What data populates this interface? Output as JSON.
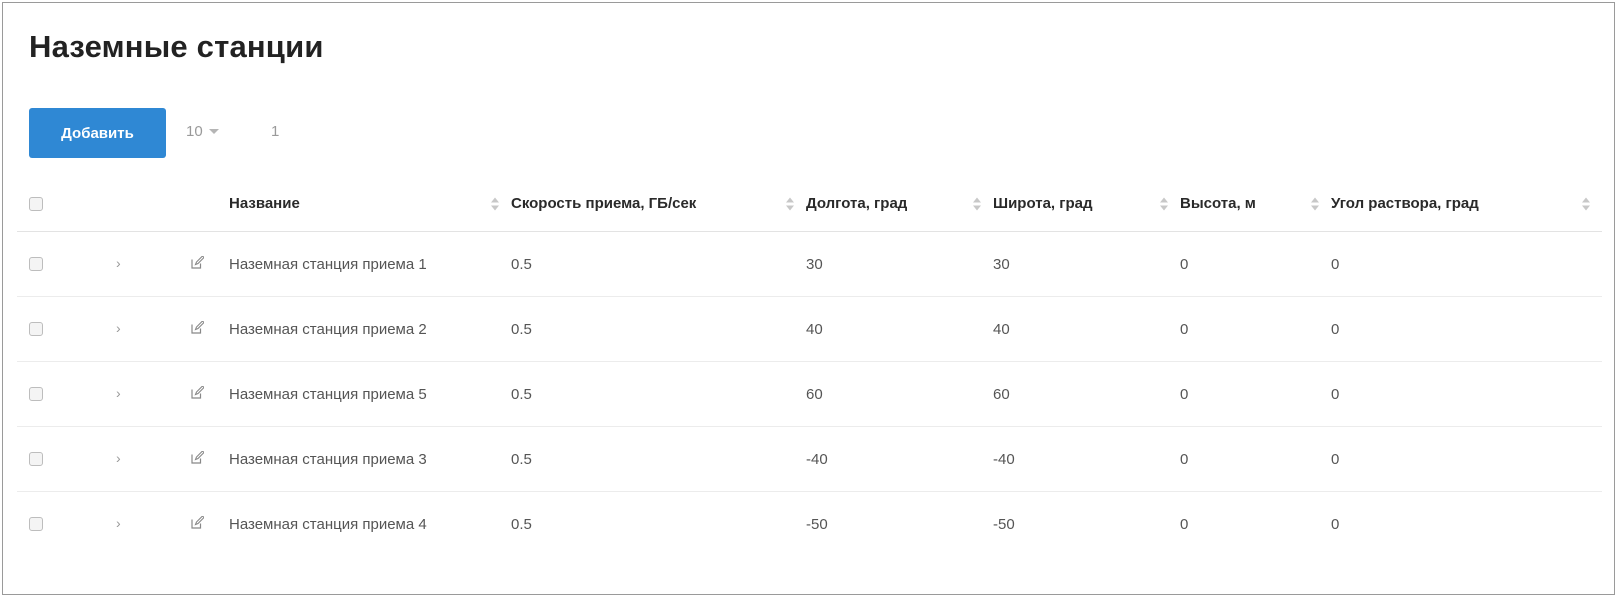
{
  "page": {
    "title": "Наземные станции"
  },
  "toolbar": {
    "add_label": "Добавить",
    "page_size": "10",
    "page_number": "1"
  },
  "table": {
    "columns": [
      "Название",
      "Скорость приема, ГБ/сек",
      "Долгота, град",
      "Широта, град",
      "Высота, м",
      "Угол раствора, град"
    ],
    "rows": [
      {
        "name": "Наземная станция приема 1",
        "speed": "0.5",
        "longitude": "30",
        "latitude": "30",
        "altitude": "0",
        "aperture": "0"
      },
      {
        "name": "Наземная станция приема 2",
        "speed": "0.5",
        "longitude": "40",
        "latitude": "40",
        "altitude": "0",
        "aperture": "0"
      },
      {
        "name": "Наземная станция приема 5",
        "speed": "0.5",
        "longitude": "60",
        "latitude": "60",
        "altitude": "0",
        "aperture": "0"
      },
      {
        "name": "Наземная станция приема 3",
        "speed": "0.5",
        "longitude": "-40",
        "latitude": "-40",
        "altitude": "0",
        "aperture": "0"
      },
      {
        "name": "Наземная станция приема 4",
        "speed": "0.5",
        "longitude": "-50",
        "latitude": "-50",
        "altitude": "0",
        "aperture": "0"
      }
    ]
  },
  "icons": {
    "row_expand": "chevron-right-icon",
    "row_edit": "edit-icon",
    "sort": "sort-icon",
    "page_size_toggle": "caret-down-icon"
  },
  "colors": {
    "accent": "#2f88d4",
    "border": "#e3e3e3"
  }
}
